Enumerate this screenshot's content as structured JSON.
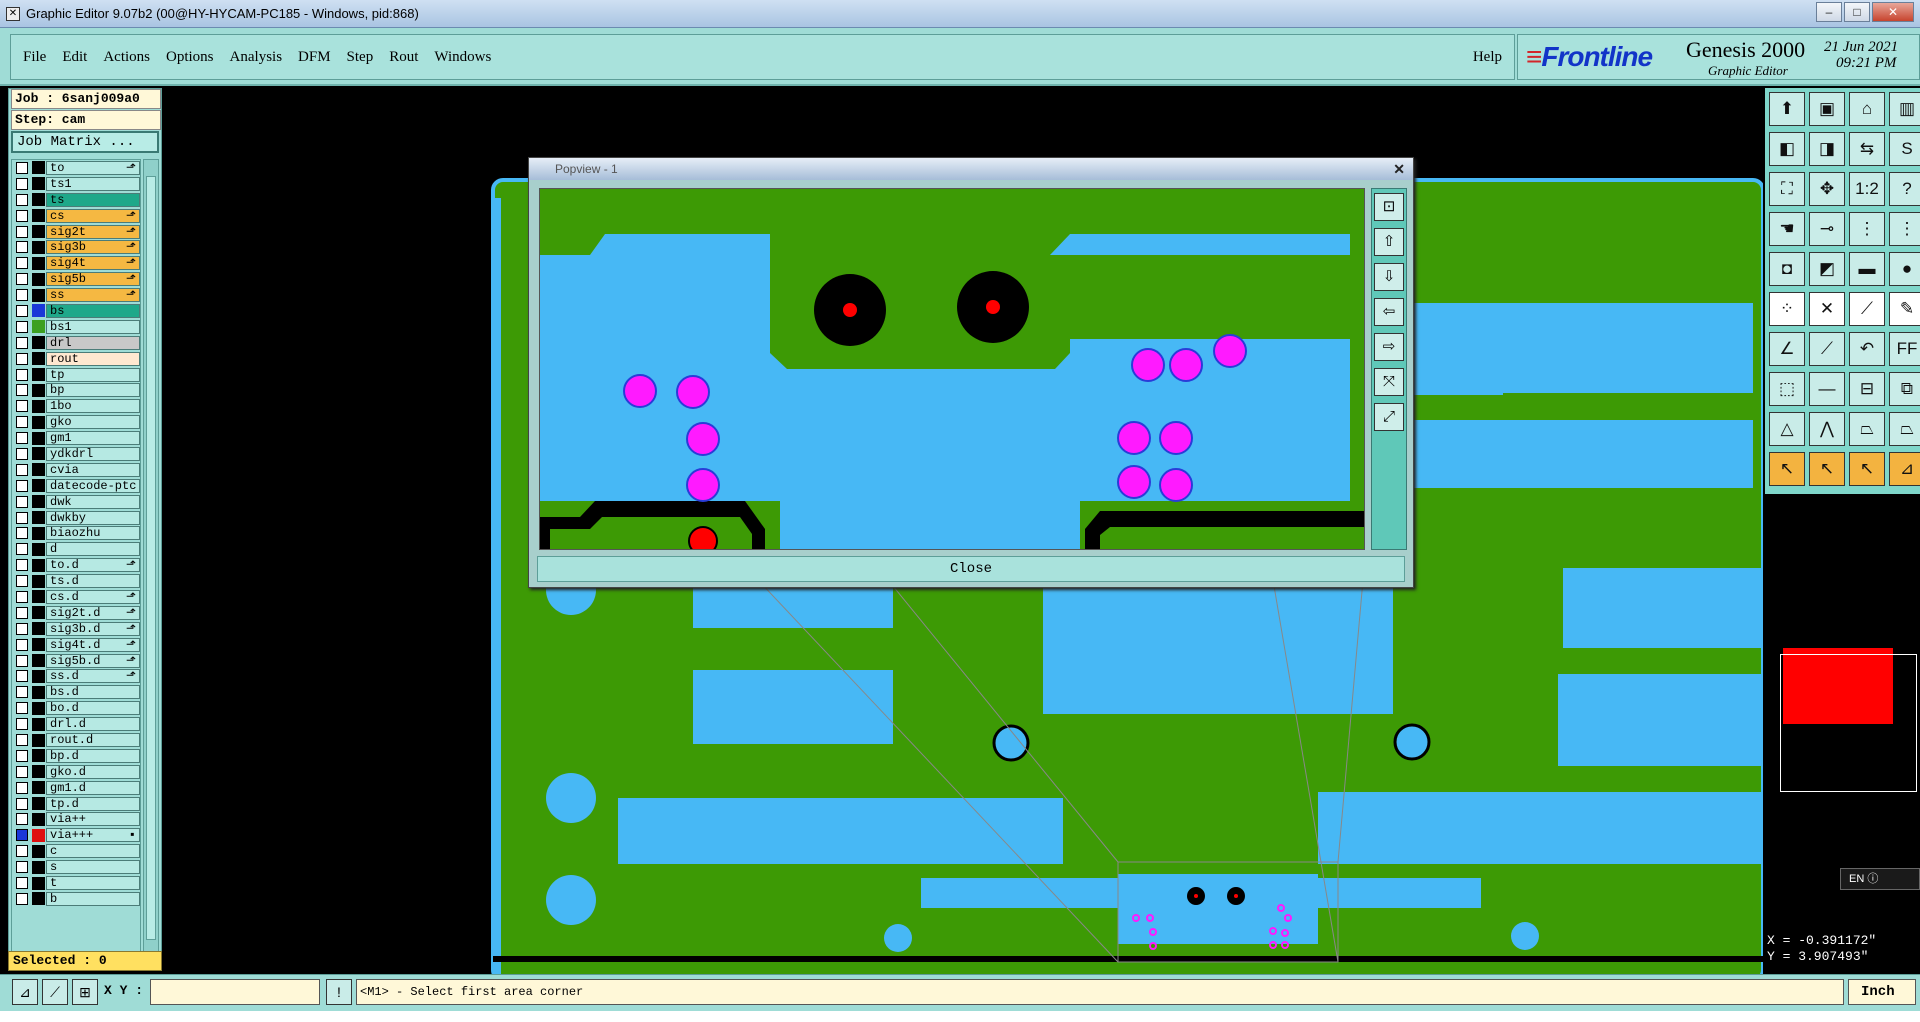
{
  "window": {
    "title": "Graphic Editor 9.07b2 (00@HY-HYCAM-PC185 - Windows, pid:868)"
  },
  "menu": {
    "items": [
      "File",
      "Edit",
      "Actions",
      "Options",
      "Analysis",
      "DFM",
      "Step",
      "Rout",
      "Windows"
    ],
    "help": "Help"
  },
  "brand": {
    "logo": "Frontline",
    "product": "Genesis 2000",
    "subtitle": "Graphic Editor",
    "date": "21 Jun 2021",
    "time": "09:21 PM"
  },
  "job": {
    "job_label": "Job : 6sanj009a0",
    "step_label": "Step: cam",
    "matrix_button": "Job Matrix ..."
  },
  "layers": [
    {
      "name": "to",
      "color": "#000000",
      "mark": "e"
    },
    {
      "name": "ts1",
      "color": "#000000",
      "mark": ""
    },
    {
      "name": "ts",
      "color": "#000000",
      "mark": "",
      "bg": "#1fa88a"
    },
    {
      "name": "cs",
      "color": "#000000",
      "mark": "e",
      "bg": "#f5b842"
    },
    {
      "name": "sig2t",
      "color": "#000000",
      "mark": "e",
      "bg": "#f5b842"
    },
    {
      "name": "sig3b",
      "color": "#000000",
      "mark": "e",
      "bg": "#f5b842"
    },
    {
      "name": "sig4t",
      "color": "#000000",
      "mark": "e",
      "bg": "#f5b842"
    },
    {
      "name": "sig5b",
      "color": "#000000",
      "mark": "e",
      "bg": "#f5b842"
    },
    {
      "name": "ss",
      "color": "#000000",
      "mark": "e",
      "bg": "#f5b842"
    },
    {
      "name": "bs",
      "color": "#1a37d8",
      "mark": "",
      "bg": "#1fa88a"
    },
    {
      "name": "bs1",
      "color": "#3ca020",
      "mark": ""
    },
    {
      "name": "drl",
      "color": "#000000",
      "mark": "",
      "bg": "#c8c8c8"
    },
    {
      "name": "rout",
      "color": "#000000",
      "mark": "",
      "bg": "#ffe8d0"
    },
    {
      "name": "tp",
      "color": "#000000",
      "mark": ""
    },
    {
      "name": "bp",
      "color": "#000000",
      "mark": ""
    },
    {
      "name": "1bo",
      "color": "#000000",
      "mark": ""
    },
    {
      "name": "gko",
      "color": "#000000",
      "mark": ""
    },
    {
      "name": "gm1",
      "color": "#000000",
      "mark": ""
    },
    {
      "name": "ydkdrl",
      "color": "#000000",
      "mark": ""
    },
    {
      "name": "cvia",
      "color": "#000000",
      "mark": ""
    },
    {
      "name": "datecode-ptc",
      "color": "#000000",
      "mark": ""
    },
    {
      "name": "dwk",
      "color": "#000000",
      "mark": ""
    },
    {
      "name": "dwkby",
      "color": "#000000",
      "mark": ""
    },
    {
      "name": "biaozhu",
      "color": "#000000",
      "mark": ""
    },
    {
      "name": "d",
      "color": "#000000",
      "mark": ""
    },
    {
      "name": "to.d",
      "color": "#000000",
      "mark": "e"
    },
    {
      "name": "ts.d",
      "color": "#000000",
      "mark": ""
    },
    {
      "name": "cs.d",
      "color": "#000000",
      "mark": "e"
    },
    {
      "name": "sig2t.d",
      "color": "#000000",
      "mark": "e"
    },
    {
      "name": "sig3b.d",
      "color": "#000000",
      "mark": "e"
    },
    {
      "name": "sig4t.d",
      "color": "#000000",
      "mark": "e"
    },
    {
      "name": "sig5b.d",
      "color": "#000000",
      "mark": "e"
    },
    {
      "name": "ss.d",
      "color": "#000000",
      "mark": "e"
    },
    {
      "name": "bs.d",
      "color": "#000000",
      "mark": ""
    },
    {
      "name": "bo.d",
      "color": "#000000",
      "mark": ""
    },
    {
      "name": "drl.d",
      "color": "#000000",
      "mark": ""
    },
    {
      "name": "rout.d",
      "color": "#000000",
      "mark": ""
    },
    {
      "name": "bp.d",
      "color": "#000000",
      "mark": ""
    },
    {
      "name": "gko.d",
      "color": "#000000",
      "mark": ""
    },
    {
      "name": "gm1.d",
      "color": "#000000",
      "mark": ""
    },
    {
      "name": "tp.d",
      "color": "#000000",
      "mark": ""
    },
    {
      "name": "via++",
      "color": "#000000",
      "mark": ""
    },
    {
      "name": "via+++",
      "color": "#e01010",
      "mark": "s",
      "checked": true
    },
    {
      "name": "c",
      "color": "#000000",
      "mark": ""
    },
    {
      "name": "s",
      "color": "#000000",
      "mark": ""
    },
    {
      "name": "t",
      "color": "#000000",
      "mark": ""
    },
    {
      "name": "b",
      "color": "#000000",
      "mark": ""
    }
  ],
  "selected": "Selected : 0",
  "popview": {
    "title": "Popview - 1",
    "close_label": "Close"
  },
  "bottom": {
    "xy_label": "X Y :",
    "xy_value": "",
    "prompt": "<M1> - Select first area corner",
    "unit": "Inch"
  },
  "coords": {
    "x": "X = -0.391172\"",
    "y": "Y = 3.907493\""
  },
  "lang": "EN",
  "colors": {
    "board_green": "#3d9a05",
    "copper_blue": "#47b8f5",
    "via_magenta": "#ff1aff",
    "drill_red": "#ff0000",
    "panel_teal": "#9fdcd6"
  }
}
